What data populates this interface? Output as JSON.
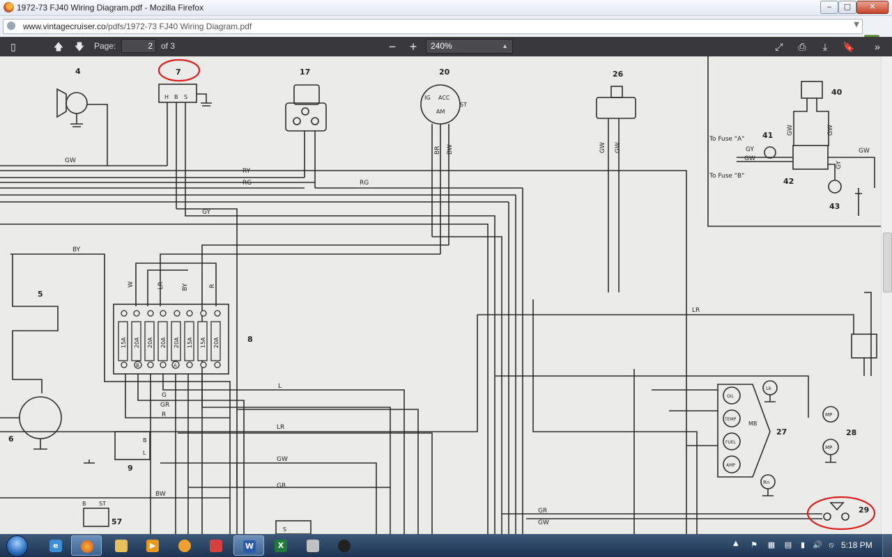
{
  "window": {
    "title": "1972-73 FJ40 Wiring Diagram.pdf - Mozilla Firefox"
  },
  "address": {
    "domain": "www.vintagecruiser.co",
    "path": "/pdfs/1972-73 FJ40 Wiring Diagram.pdf"
  },
  "pdf_toolbar": {
    "page_label": "Page:",
    "page_value": "2",
    "page_of": "of 3",
    "zoom": "240%"
  },
  "diagram": {
    "numbers": [
      "4",
      "7",
      "17",
      "20",
      "26",
      "40",
      "41",
      "42",
      "43",
      "5",
      "8",
      "6",
      "9",
      "27",
      "28",
      "29",
      "57"
    ],
    "wire_labels": [
      "GW",
      "RY",
      "RG",
      "RG",
      "GY",
      "BY",
      "W",
      "LR",
      "BY",
      "R",
      "L",
      "G",
      "GR",
      "R",
      "LR",
      "GW",
      "GR",
      "BW",
      "GR",
      "GW",
      "LR",
      "BR",
      "BW",
      "GW",
      "GW",
      "GW",
      "GW",
      "GY",
      "GW",
      "GW",
      "GY"
    ],
    "terminal_labels": {
      "horn_relay": [
        "H",
        "B",
        "S"
      ],
      "ignition": [
        "IG",
        "ACC",
        "ST",
        "AM"
      ],
      "fuses": [
        "15A",
        "20A",
        "20A",
        "20A",
        "20A",
        "15A",
        "15A",
        "20A"
      ],
      "gauges": [
        "OIL",
        "TEMP",
        "FUEL",
        "AMP"
      ],
      "gauge_misc": [
        "MB",
        "Lk",
        "Rn",
        "MP",
        "MP"
      ],
      "misc": [
        "B",
        "L",
        "B",
        "ST",
        "S"
      ]
    },
    "fuse_notes": [
      "To Fuse \"A\"",
      "To Fuse \"B\""
    ],
    "fuse_marks": [
      "B",
      "A"
    ]
  },
  "taskbar": {
    "clock": "5:18 PM"
  }
}
